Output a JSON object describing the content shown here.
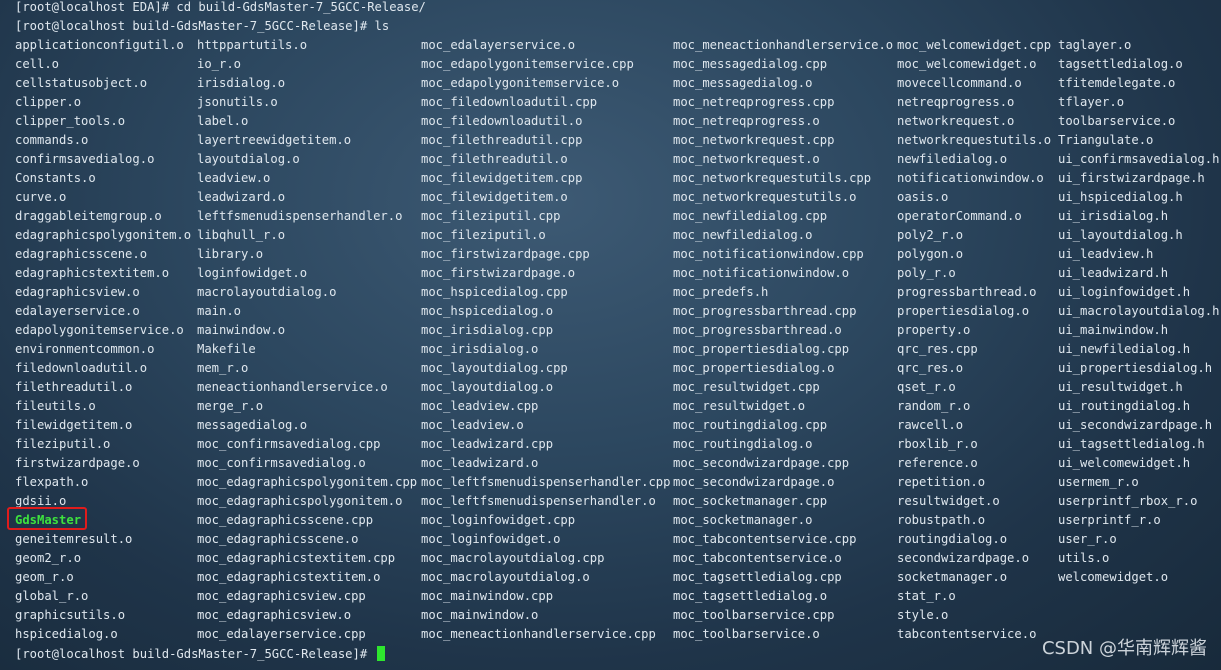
{
  "terminal": {
    "previous_line": "[root@localhost EDA]# cd build-GdsMaster-7_5GCC-Release/",
    "ls_command_line": "[root@localhost build-GdsMaster-7_5GCC-Release]# ls",
    "final_prompt": "[root@localhost build-GdsMaster-7_5GCC-Release]# ",
    "executable_color": "#3ee23e",
    "highlight_color": "#e01c1c",
    "highlighted_entry": "GdsMaster",
    "columns": [
      [
        "applicationconfigutil.o",
        "cell.o",
        "cellstatusobject.o",
        "clipper.o",
        "clipper_tools.o",
        "commands.o",
        "confirmsavedialog.o",
        "Constants.o",
        "curve.o",
        "draggableitemgroup.o",
        "edagraphicspolygonitem.o",
        "edagraphicsscene.o",
        "edagraphicstextitem.o",
        "edagraphicsview.o",
        "edalayerservice.o",
        "edapolygonitemservice.o",
        "environmentcommon.o",
        "filedownloadutil.o",
        "filethreadutil.o",
        "fileutils.o",
        "filewidgetitem.o",
        "fileziputil.o",
        "firstwizardpage.o",
        "flexpath.o",
        "gdsii.o",
        "GdsMaster",
        "geneitemresult.o",
        "geom2_r.o",
        "geom_r.o",
        "global_r.o",
        "graphicsutils.o",
        "hspicedialog.o"
      ],
      [
        "httppartutils.o",
        "io_r.o",
        "irisdialog.o",
        "jsonutils.o",
        "label.o",
        "layertreewidgetitem.o",
        "layoutdialog.o",
        "leadview.o",
        "leadwizard.o",
        "leftfsmenudispenserhandler.o",
        "libqhull_r.o",
        "library.o",
        "loginfowidget.o",
        "macrolayoutdialog.o",
        "main.o",
        "mainwindow.o",
        "Makefile",
        "mem_r.o",
        "meneactionhandlerservice.o",
        "merge_r.o",
        "messagedialog.o",
        "moc_confirmsavedialog.cpp",
        "moc_confirmsavedialog.o",
        "moc_edagraphicspolygonitem.cpp",
        "moc_edagraphicspolygonitem.o",
        "moc_edagraphicsscene.cpp",
        "moc_edagraphicsscene.o",
        "moc_edagraphicstextitem.cpp",
        "moc_edagraphicstextitem.o",
        "moc_edagraphicsview.cpp",
        "moc_edagraphicsview.o",
        "moc_edalayerservice.cpp"
      ],
      [
        "moc_edalayerservice.o",
        "moc_edapolygonitemservice.cpp",
        "moc_edapolygonitemservice.o",
        "moc_filedownloadutil.cpp",
        "moc_filedownloadutil.o",
        "moc_filethreadutil.cpp",
        "moc_filethreadutil.o",
        "moc_filewidgetitem.cpp",
        "moc_filewidgetitem.o",
        "moc_fileziputil.cpp",
        "moc_fileziputil.o",
        "moc_firstwizardpage.cpp",
        "moc_firstwizardpage.o",
        "moc_hspicedialog.cpp",
        "moc_hspicedialog.o",
        "moc_irisdialog.cpp",
        "moc_irisdialog.o",
        "moc_layoutdialog.cpp",
        "moc_layoutdialog.o",
        "moc_leadview.cpp",
        "moc_leadview.o",
        "moc_leadwizard.cpp",
        "moc_leadwizard.o",
        "moc_leftfsmenudispenserhandler.cpp",
        "moc_leftfsmenudispenserhandler.o",
        "moc_loginfowidget.cpp",
        "moc_loginfowidget.o",
        "moc_macrolayoutdialog.cpp",
        "moc_macrolayoutdialog.o",
        "moc_mainwindow.cpp",
        "moc_mainwindow.o",
        "moc_meneactionhandlerservice.cpp"
      ],
      [
        "moc_meneactionhandlerservice.o",
        "moc_messagedialog.cpp",
        "moc_messagedialog.o",
        "moc_netreqprogress.cpp",
        "moc_netreqprogress.o",
        "moc_networkrequest.cpp",
        "moc_networkrequest.o",
        "moc_networkrequestutils.cpp",
        "moc_networkrequestutils.o",
        "moc_newfiledialog.cpp",
        "moc_newfiledialog.o",
        "moc_notificationwindow.cpp",
        "moc_notificationwindow.o",
        "moc_predefs.h",
        "moc_progressbarthread.cpp",
        "moc_progressbarthread.o",
        "moc_propertiesdialog.cpp",
        "moc_propertiesdialog.o",
        "moc_resultwidget.cpp",
        "moc_resultwidget.o",
        "moc_routingdialog.cpp",
        "moc_routingdialog.o",
        "moc_secondwizardpage.cpp",
        "moc_secondwizardpage.o",
        "moc_socketmanager.cpp",
        "moc_socketmanager.o",
        "moc_tabcontentservice.cpp",
        "moc_tabcontentservice.o",
        "moc_tagsettledialog.cpp",
        "moc_tagsettledialog.o",
        "moc_toolbarservice.cpp",
        "moc_toolbarservice.o"
      ],
      [
        "moc_welcomewidget.cpp",
        "moc_welcomewidget.o",
        "movecellcommand.o",
        "netreqprogress.o",
        "networkrequest.o",
        "networkrequestutils.o",
        "newfiledialog.o",
        "notificationwindow.o",
        "oasis.o",
        "operatorCommand.o",
        "poly2_r.o",
        "polygon.o",
        "poly_r.o",
        "progressbarthread.o",
        "propertiesdialog.o",
        "property.o",
        "qrc_res.cpp",
        "qrc_res.o",
        "qset_r.o",
        "random_r.o",
        "rawcell.o",
        "rboxlib_r.o",
        "reference.o",
        "repetition.o",
        "resultwidget.o",
        "robustpath.o",
        "routingdialog.o",
        "secondwizardpage.o",
        "socketmanager.o",
        "stat_r.o",
        "style.o",
        "tabcontentservice.o"
      ],
      [
        "taglayer.o",
        "tagsettledialog.o",
        "tfitemdelegate.o",
        "tflayer.o",
        "toolbarservice.o",
        "Triangulate.o",
        "ui_confirmsavedialog.h",
        "ui_firstwizardpage.h",
        "ui_hspicedialog.h",
        "ui_irisdialog.h",
        "ui_layoutdialog.h",
        "ui_leadview.h",
        "ui_leadwizard.h",
        "ui_loginfowidget.h",
        "ui_macrolayoutdialog.h",
        "ui_mainwindow.h",
        "ui_newfiledialog.h",
        "ui_propertiesdialog.h",
        "ui_resultwidget.h",
        "ui_routingdialog.h",
        "ui_secondwizardpage.h",
        "ui_tagsettledialog.h",
        "ui_welcomewidget.h",
        "usermem_r.o",
        "userprintf_rbox_r.o",
        "userprintf_r.o",
        "user_r.o",
        "utils.o",
        "welcomewidget.o"
      ]
    ]
  },
  "watermark": {
    "text": "CSDN @华南辉辉酱"
  }
}
